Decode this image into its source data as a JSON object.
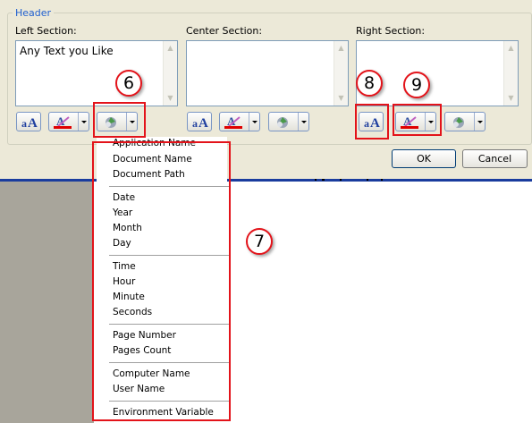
{
  "group_title": "Header",
  "sections": [
    {
      "label": "Left Section:",
      "text": "Any Text you Like"
    },
    {
      "label": "Center Section:",
      "text": ""
    },
    {
      "label": "Right Section:",
      "text": ""
    }
  ],
  "buttons": {
    "ok": "OK",
    "cancel": "Cancel"
  },
  "menu": {
    "groups": [
      [
        "Application Name",
        "Document Name",
        "Document Path"
      ],
      [
        "Date",
        "Year",
        "Month",
        "Day"
      ],
      [
        "Time",
        "Hour",
        "Minute",
        "Seconds"
      ],
      [
        "Page Number",
        "Pages Count"
      ],
      [
        "Computer Name",
        "User Name"
      ],
      [
        "Environment Variable"
      ]
    ]
  },
  "callouts": [
    "6",
    "7",
    "8",
    "9"
  ],
  "colors": {
    "dialog_bg": "#ece9d8",
    "accent": "#1f5fcf",
    "highlight": "#e3131a",
    "rule": "#1a3c9e"
  },
  "icons": [
    "font-icon",
    "text-color-icon",
    "insert-field-icon",
    "scroll-up-icon",
    "scroll-down-icon"
  ]
}
